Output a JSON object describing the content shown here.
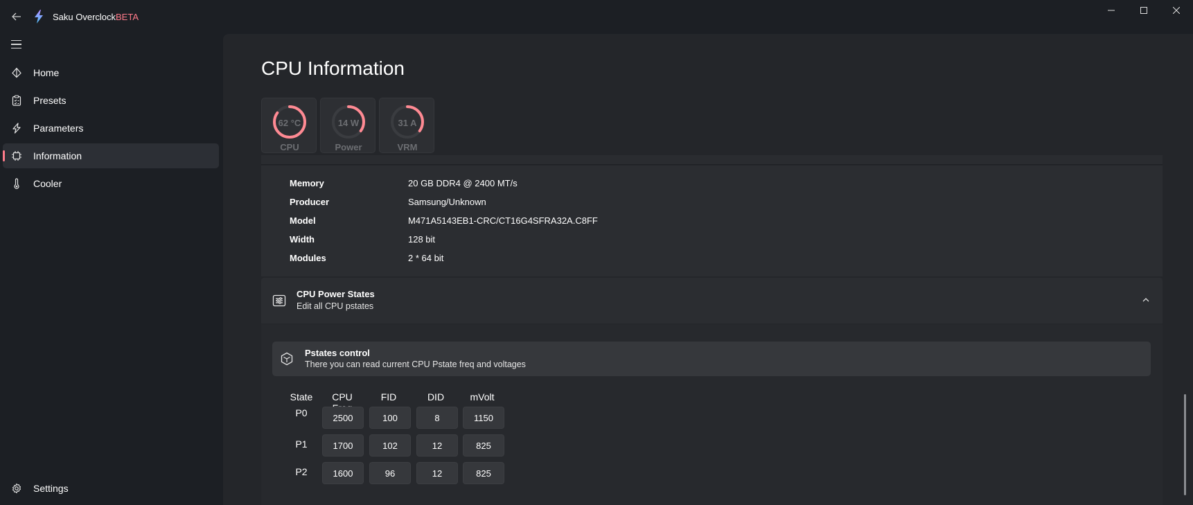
{
  "app": {
    "title": "Saku Overclock",
    "badge": "BETA"
  },
  "colors": {
    "accent": "#ff7b8a",
    "background": "#1c1f24",
    "panel": "#24262a"
  },
  "sidebar": {
    "items": [
      {
        "label": "Home",
        "icon": "home-icon"
      },
      {
        "label": "Presets",
        "icon": "clipboard-icon"
      },
      {
        "label": "Parameters",
        "icon": "lightning-icon"
      },
      {
        "label": "Information",
        "icon": "chip-icon",
        "active": true
      },
      {
        "label": "Cooler",
        "icon": "thermometer-icon"
      }
    ],
    "settings_label": "Settings"
  },
  "page": {
    "title": "CPU Information"
  },
  "gauges": [
    {
      "value": "62 °C",
      "label": "CPU",
      "level": 0.85
    },
    {
      "value": "14 W",
      "label": "Power",
      "level": 0.35
    },
    {
      "value": "31 A",
      "label": "VRM",
      "level": 0.35
    }
  ],
  "memory": {
    "rows": [
      {
        "key": "Memory",
        "value": "20 GB DDR4 @ 2400 MT/s"
      },
      {
        "key": "Producer",
        "value": "Samsung/Unknown"
      },
      {
        "key": "Model",
        "value": "M471A5143EB1-CRC/CT16G4SFRA32A.C8FF"
      },
      {
        "key": "Width",
        "value": "128 bit"
      },
      {
        "key": "Modules",
        "value": "2 * 64 bit"
      }
    ]
  },
  "power_states": {
    "title": "CPU Power States",
    "subtitle": "Edit all CPU pstates",
    "control_title": "Pstates control",
    "control_subtitle": "There you can read current CPU Pstate freq and voltages",
    "headers": [
      "State",
      "CPU Freq",
      "FID",
      "DID",
      "mVolt"
    ],
    "rows": [
      {
        "state": "P0",
        "freq": "2500",
        "fid": "100",
        "did": "8",
        "mvolt": "1150"
      },
      {
        "state": "P1",
        "freq": "1700",
        "fid": "102",
        "did": "12",
        "mvolt": "825"
      },
      {
        "state": "P2",
        "freq": "1600",
        "fid": "96",
        "did": "12",
        "mvolt": "825"
      }
    ]
  }
}
